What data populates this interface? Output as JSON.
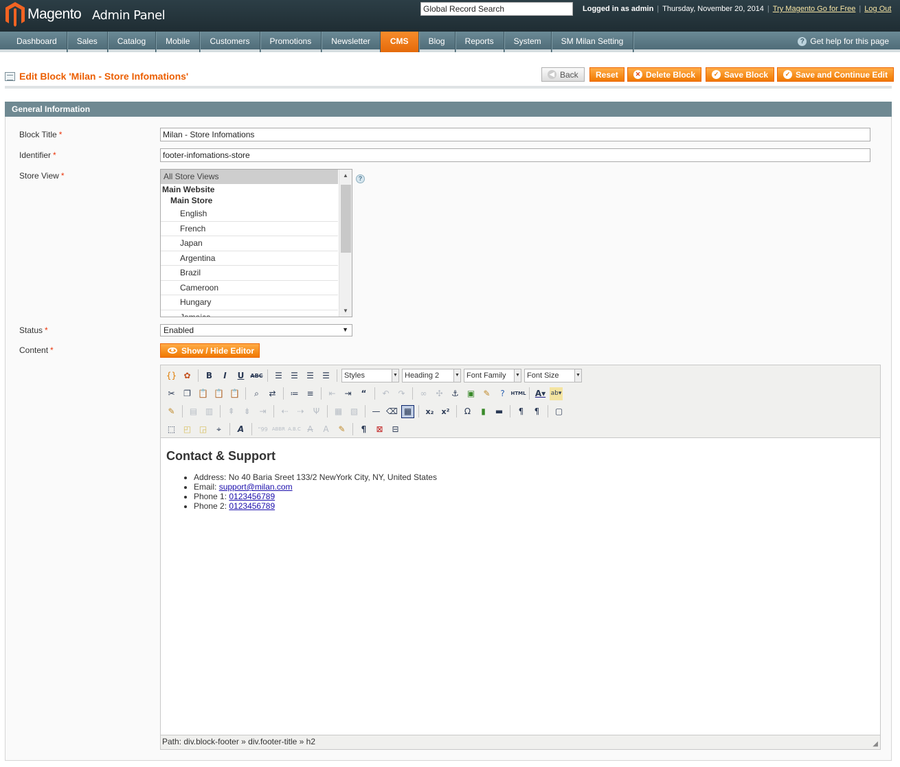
{
  "header": {
    "brand": "Magento",
    "brand_sub": "Admin Panel",
    "search_value": "Global Record Search",
    "logged_in": "Logged in as admin",
    "date": "Thursday, November 20, 2014",
    "try_link": "Try Magento Go for Free",
    "logout": "Log Out"
  },
  "nav": {
    "items": [
      "Dashboard",
      "Sales",
      "Catalog",
      "Mobile",
      "Customers",
      "Promotions",
      "Newsletter",
      "CMS",
      "Blog",
      "Reports",
      "System",
      "SM Milan Setting"
    ],
    "active": "CMS",
    "help": "Get help for this page"
  },
  "page": {
    "title": "Edit Block 'Milan - Store Infomations'",
    "buttons": {
      "back": "Back",
      "reset": "Reset",
      "delete": "Delete Block",
      "save": "Save Block",
      "save_continue": "Save and Continue Edit"
    }
  },
  "form": {
    "section_title": "General Information",
    "block_title_label": "Block Title",
    "block_title_value": "Milan - Store Infomations",
    "identifier_label": "Identifier",
    "identifier_value": "footer-infomations-store",
    "store_view_label": "Store View",
    "store_options": {
      "all": "All Store Views",
      "website": "Main Website",
      "store": "Main Store",
      "views": [
        "English",
        "French",
        "Japan",
        "Argentina",
        "Brazil",
        "Cameroon",
        "Hungary",
        "Jamaica"
      ]
    },
    "status_label": "Status",
    "status_value": "Enabled",
    "content_label": "Content",
    "toggle_editor": "Show / Hide Editor",
    "required_mark": "*"
  },
  "editor": {
    "styles": "Styles",
    "format": "Heading 2",
    "font_family": "Font Family",
    "font_size": "Font Size",
    "heading": "Contact & Support",
    "address": "Address: No 40 Baria Sreet 133/2 NewYork City, NY, United States",
    "email_label": "Email: ",
    "email": "support@milan.com",
    "phone1_label": "Phone 1: ",
    "phone1": "0123456789",
    "phone2_label": "Phone 2: ",
    "phone2": "0123456789",
    "path": "Path: div.block-footer » div.footer-title » h2"
  }
}
